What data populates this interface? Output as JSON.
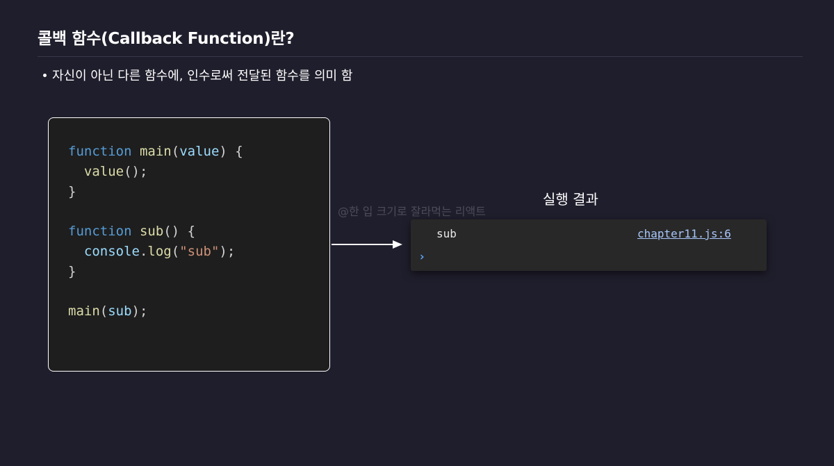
{
  "slide": {
    "title": "콜백 함수(Callback Function)란?",
    "bullet": "자신이 아닌 다른 함수에, 인수로써 전달된 함수를 의미 함",
    "result_label": "실행 결과",
    "watermark": "@한 입 크기로 잘라먹는 리액트"
  },
  "code": {
    "lines": [
      [
        {
          "text": "function",
          "kind": "keyword"
        },
        {
          "text": " ",
          "kind": "plain"
        },
        {
          "text": "main",
          "kind": "function"
        },
        {
          "text": "(",
          "kind": "plain"
        },
        {
          "text": "value",
          "kind": "variable"
        },
        {
          "text": ") {",
          "kind": "plain"
        }
      ],
      [
        {
          "text": "  ",
          "kind": "plain"
        },
        {
          "text": "value",
          "kind": "function"
        },
        {
          "text": "();",
          "kind": "plain"
        }
      ],
      [
        {
          "text": "}",
          "kind": "plain"
        }
      ],
      [],
      [
        {
          "text": "function",
          "kind": "keyword"
        },
        {
          "text": " ",
          "kind": "plain"
        },
        {
          "text": "sub",
          "kind": "function"
        },
        {
          "text": "() {",
          "kind": "plain"
        }
      ],
      [
        {
          "text": "  ",
          "kind": "plain"
        },
        {
          "text": "console",
          "kind": "variable"
        },
        {
          "text": ".",
          "kind": "plain"
        },
        {
          "text": "log",
          "kind": "function"
        },
        {
          "text": "(",
          "kind": "plain"
        },
        {
          "text": "\"sub\"",
          "kind": "string"
        },
        {
          "text": ");",
          "kind": "plain"
        }
      ],
      [
        {
          "text": "}",
          "kind": "plain"
        }
      ],
      [],
      [
        {
          "text": "main",
          "kind": "function"
        },
        {
          "text": "(",
          "kind": "plain"
        },
        {
          "text": "sub",
          "kind": "variable"
        },
        {
          "text": ");",
          "kind": "plain"
        }
      ]
    ]
  },
  "console": {
    "output": "sub",
    "source": "chapter11.js:6",
    "prompt": "›"
  }
}
